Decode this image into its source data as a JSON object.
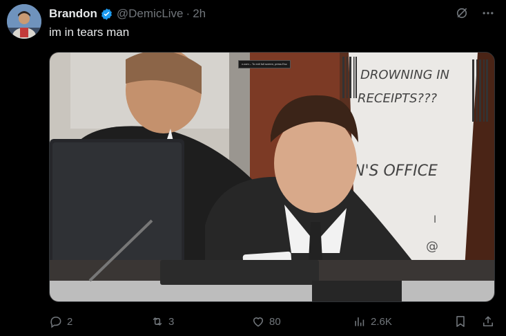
{
  "post": {
    "author_name": "Brandon",
    "handle": "@DemicLive",
    "separator": "·",
    "time": "2h",
    "text": "im in tears man",
    "verified": true
  },
  "media": {
    "sign_line1": "DROWNING IN",
    "sign_line2": "RECEIPTS???",
    "sign_line3": "N'S OFFICE",
    "sign_letter": "I",
    "sign_at": "@",
    "overlay_note": "x.com – To exit full screen, press Esc"
  },
  "actions": {
    "replies": "2",
    "reposts": "3",
    "likes": "80",
    "views": "2.6K"
  },
  "colors": {
    "background": "#000000",
    "text_primary": "#e7e9ea",
    "text_secondary": "#71767b",
    "verified": "#1d9bf0"
  },
  "icons": [
    "grok-icon",
    "more-icon",
    "reply-icon",
    "repost-icon",
    "like-icon",
    "views-icon",
    "bookmark-icon",
    "share-icon"
  ]
}
